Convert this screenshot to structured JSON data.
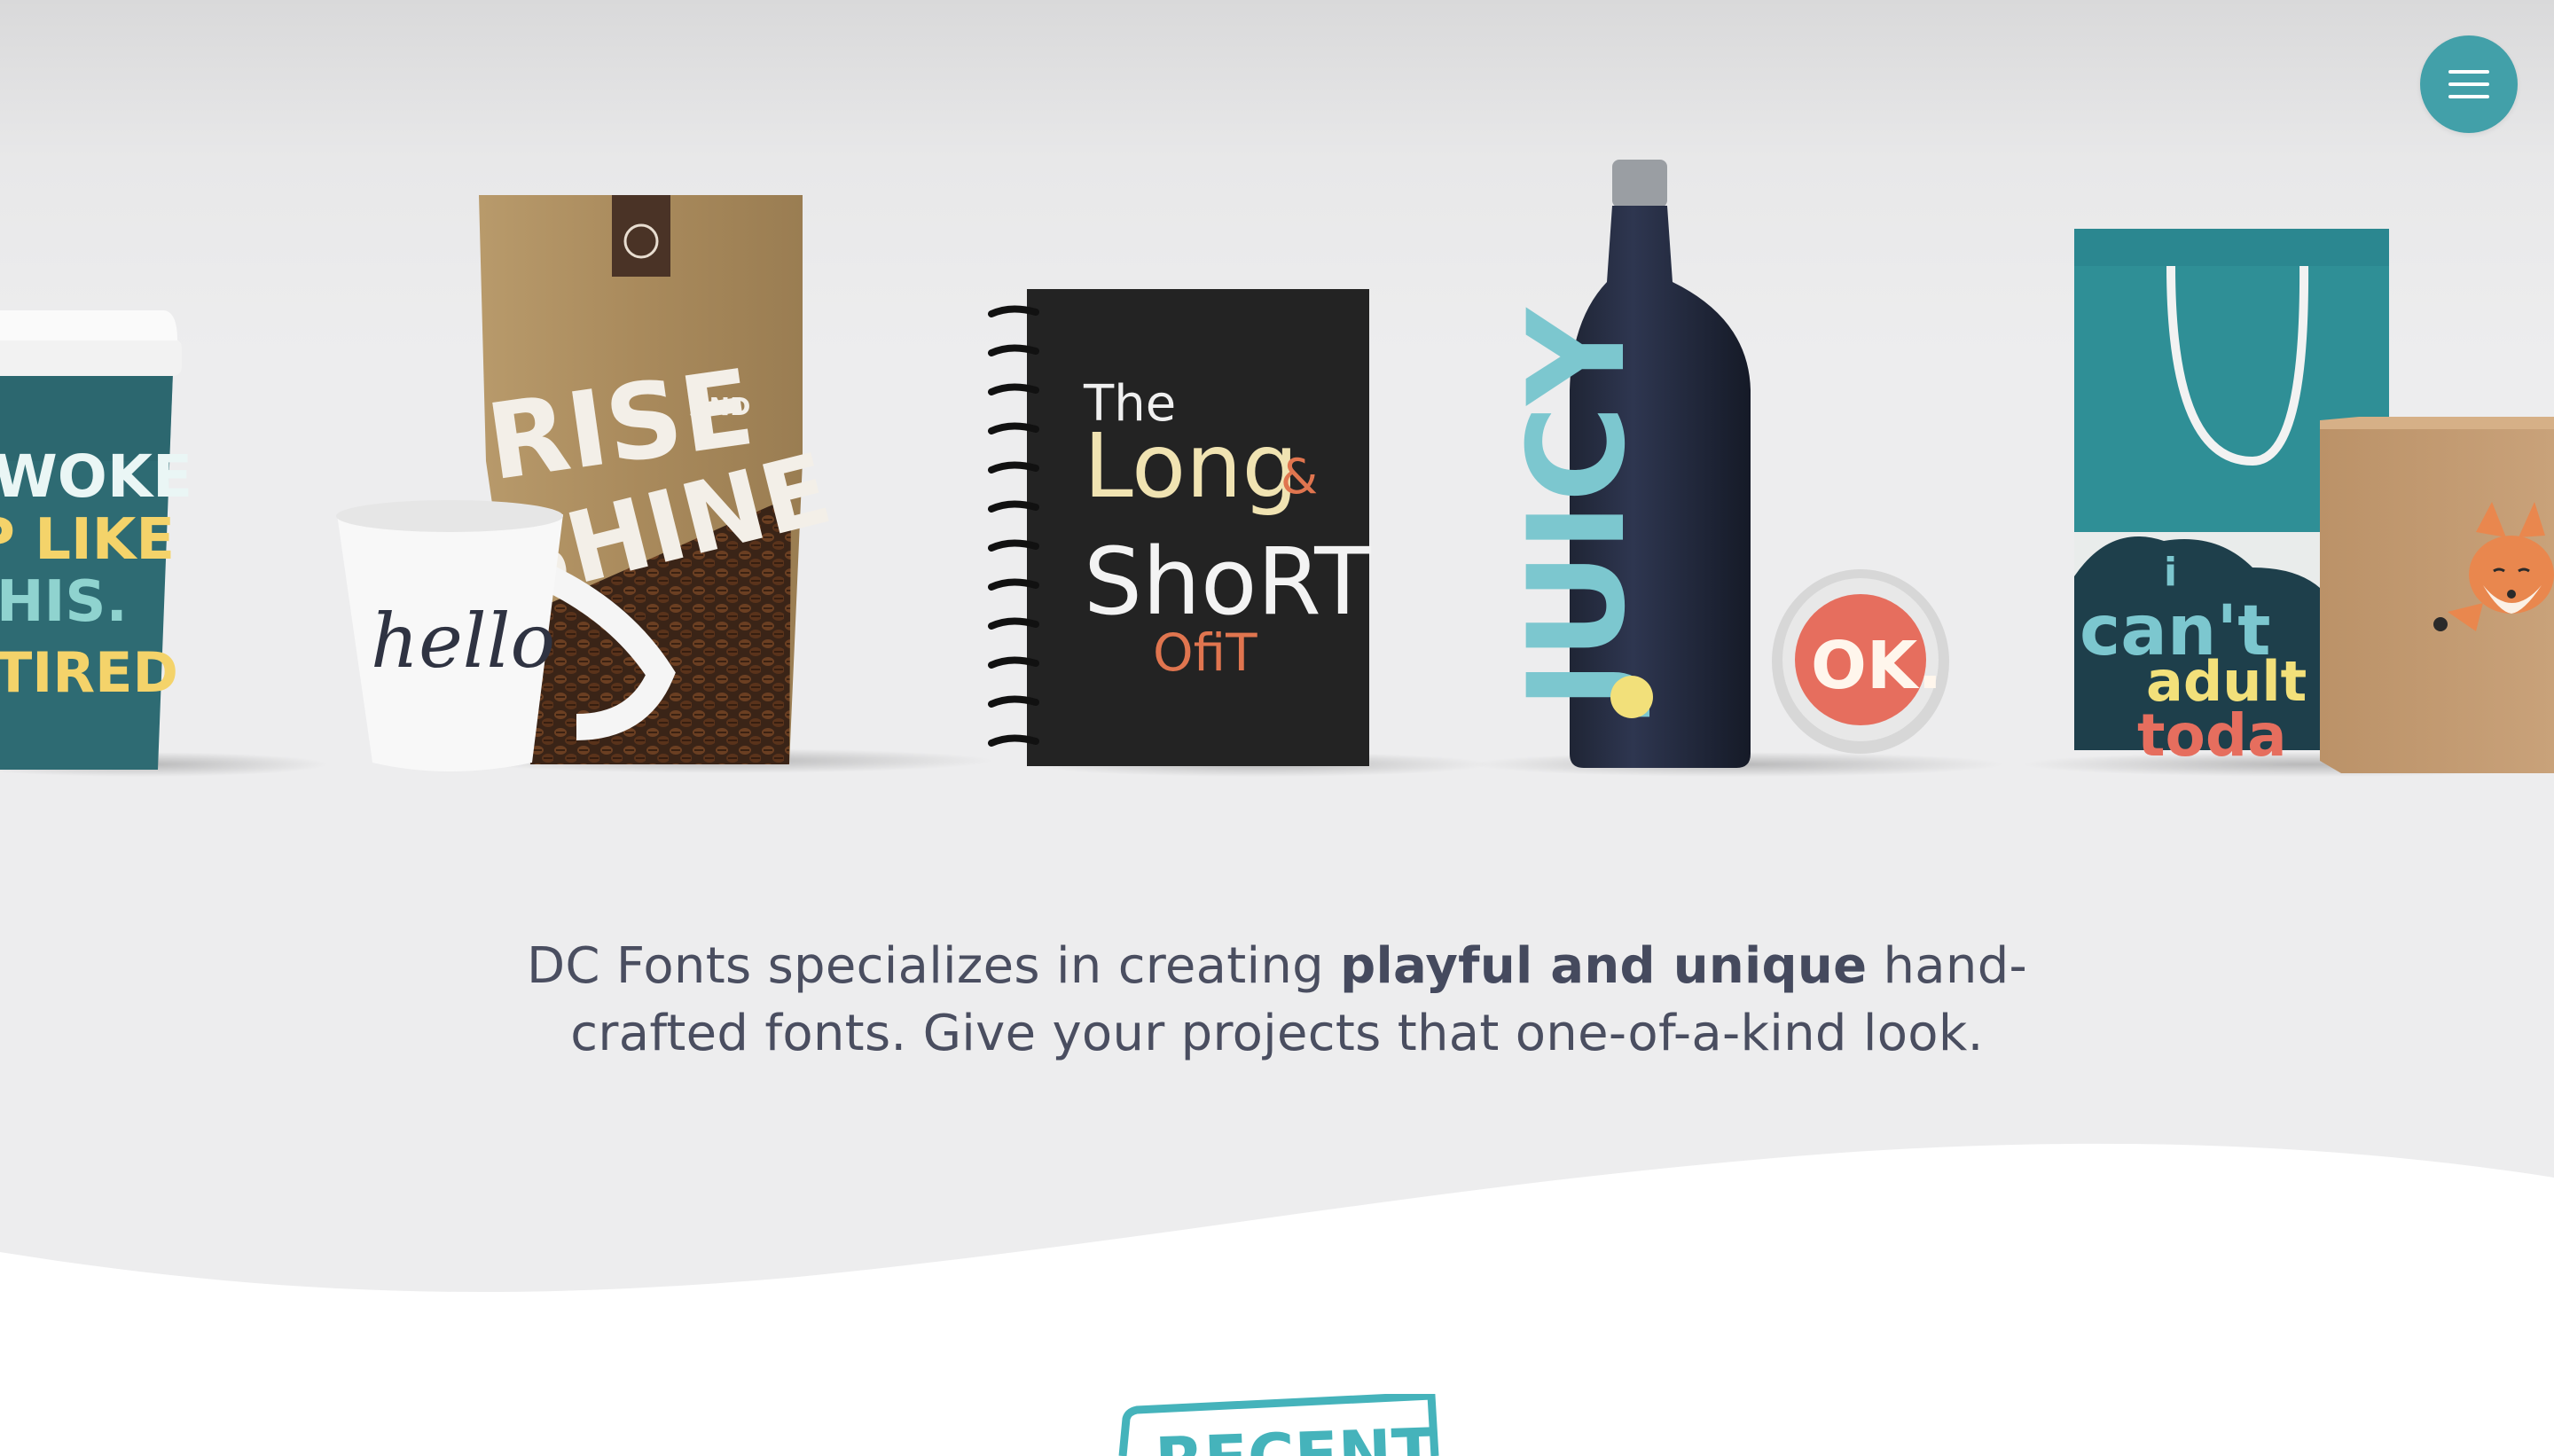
{
  "header": {
    "menu_icon": "hamburger-icon",
    "accent_color": "#42a0a9"
  },
  "products": {
    "cup_lines": [
      "WOKE",
      "P LIKE",
      "HIS.",
      "TIRED"
    ],
    "bag_text_1": "RISE",
    "bag_text_2": "SHINE",
    "bag_text_and": "AND",
    "mug_text": "hello",
    "notebook_line1": "The",
    "notebook_line2": "Long",
    "notebook_amp": "&",
    "notebook_line3": "ShoRT",
    "notebook_line4": "OfiT",
    "bottle_text": "JUICY",
    "tin_text": "OK.",
    "sticker_line1": "i",
    "sticker_line2": "can't",
    "sticker_line3": "adult",
    "sticker_line4": "toda"
  },
  "tagline": {
    "part1": "DC Fonts specializes in creating ",
    "bold": "playful and unique",
    "part2": " hand-crafted fonts. Give your projects that one-of-a-kind look."
  },
  "recent": {
    "label": "RECENT"
  }
}
